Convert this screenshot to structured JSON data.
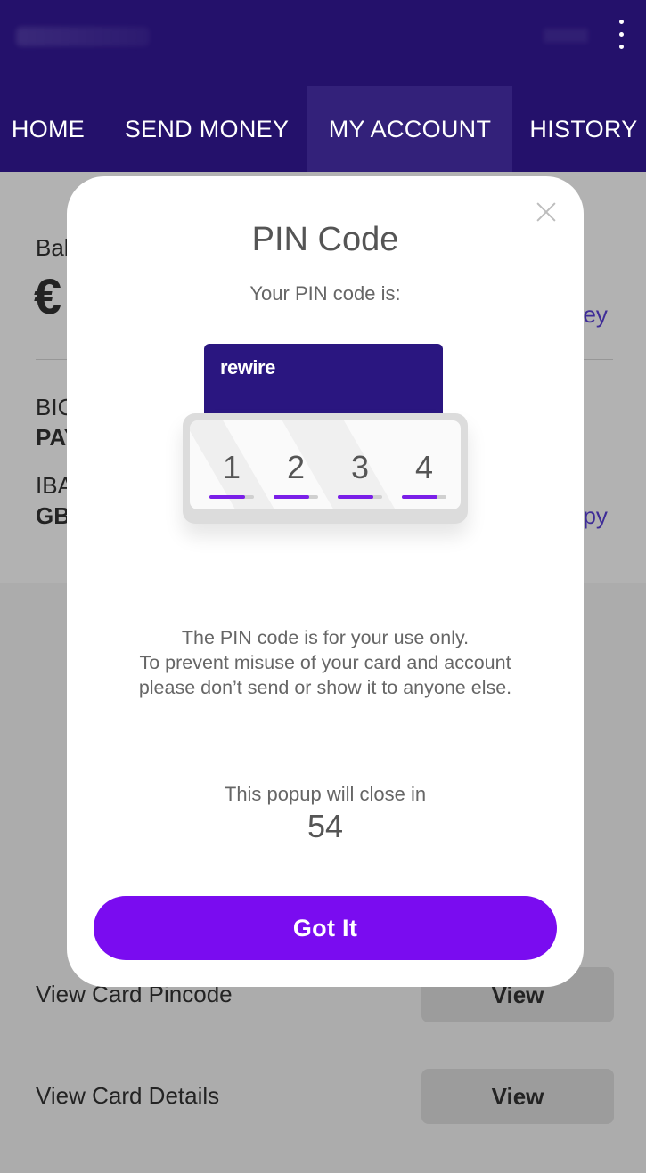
{
  "nav": {
    "tabs": [
      {
        "label": "HOME"
      },
      {
        "label": "SEND MONEY"
      },
      {
        "label": "MY ACCOUNT",
        "active": true
      },
      {
        "label": "HISTORY"
      }
    ]
  },
  "background": {
    "balance_label_partial": "Bal",
    "currency_symbol": "€",
    "send_money_partial": "ney",
    "bic_label_partial": "BIC",
    "bic_value_partial": "PAY",
    "iban_label_partial": "IBA",
    "iban_value_partial": "GB",
    "copy_partial": "opy",
    "rows": [
      {
        "label": "View Card Pincode",
        "button": "View"
      },
      {
        "label": "View Card Details",
        "button": "View"
      }
    ]
  },
  "modal": {
    "title": "PIN Code",
    "subtitle": "Your PIN code is:",
    "card_brand": "rewire",
    "pin_digits": [
      "1",
      "2",
      "3",
      "4"
    ],
    "note_lines": [
      "The PIN code is for your use only.",
      "To prevent misuse of your card and account",
      "please don’t send or show it to anyone else."
    ],
    "countdown_label": "This popup will close in",
    "countdown_value": "54",
    "button_label": "Got It"
  },
  "colors": {
    "header_bg": "#24116b",
    "active_tab_bg": "#33217a",
    "accent": "#7a0cf0",
    "card": "#2a1680"
  },
  "icons": [
    "more-vert-icon",
    "close-icon"
  ]
}
